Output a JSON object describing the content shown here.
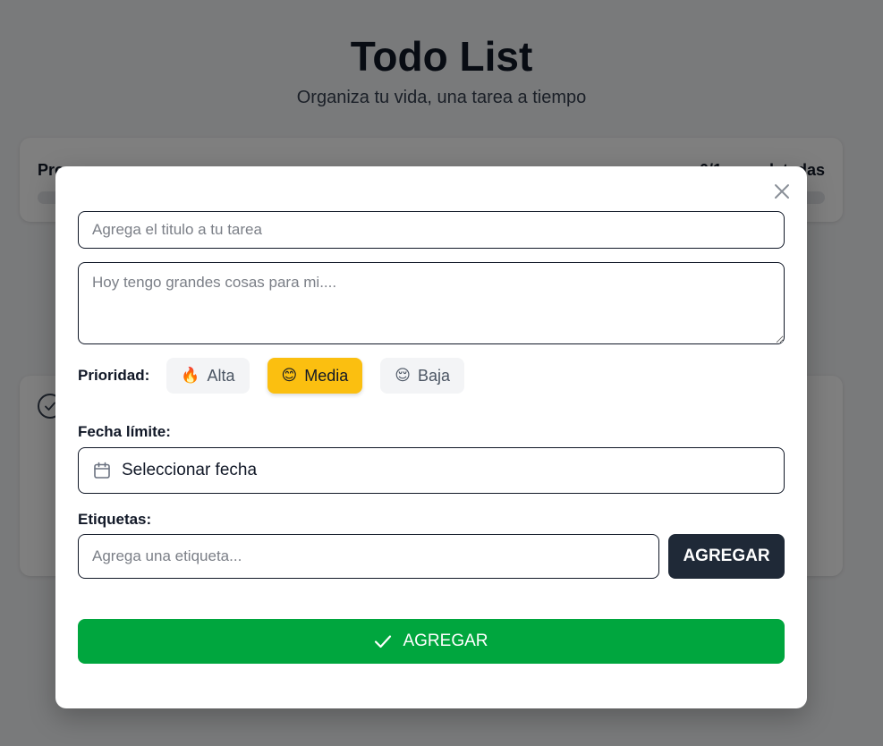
{
  "app": {
    "title": "Todo List",
    "subtitle": "Organiza tu vida, una tarea a tiempo"
  },
  "progress": {
    "label": "Pro",
    "count_text": "0/1 completadas",
    "percent": 0
  },
  "modal": {
    "title_placeholder": "Agrega el titulo a tu tarea",
    "description_placeholder": "Hoy tengo grandes cosas para mi....",
    "priority_label": "Prioridad:",
    "priorities": [
      {
        "emoji": "🔥",
        "label": "Alta",
        "selected": false
      },
      {
        "emoji": "😊",
        "label": "Media",
        "selected": true
      },
      {
        "emoji": "😌",
        "label": "Baja",
        "selected": false
      }
    ],
    "date_label": "Fecha límite:",
    "date_placeholder": "Seleccionar fecha",
    "tags_label": "Etiquetas:",
    "tag_placeholder": "Agrega una etiqueta...",
    "tag_add_label": "AGREGAR",
    "submit_label": "AGREGAR"
  },
  "icons": {
    "close": "close-icon",
    "calendar": "calendar-icon",
    "check": "check-icon"
  },
  "colors": {
    "selected_priority": "#fbbf10",
    "submit": "#00a63e",
    "tag_button": "#1f2937"
  }
}
